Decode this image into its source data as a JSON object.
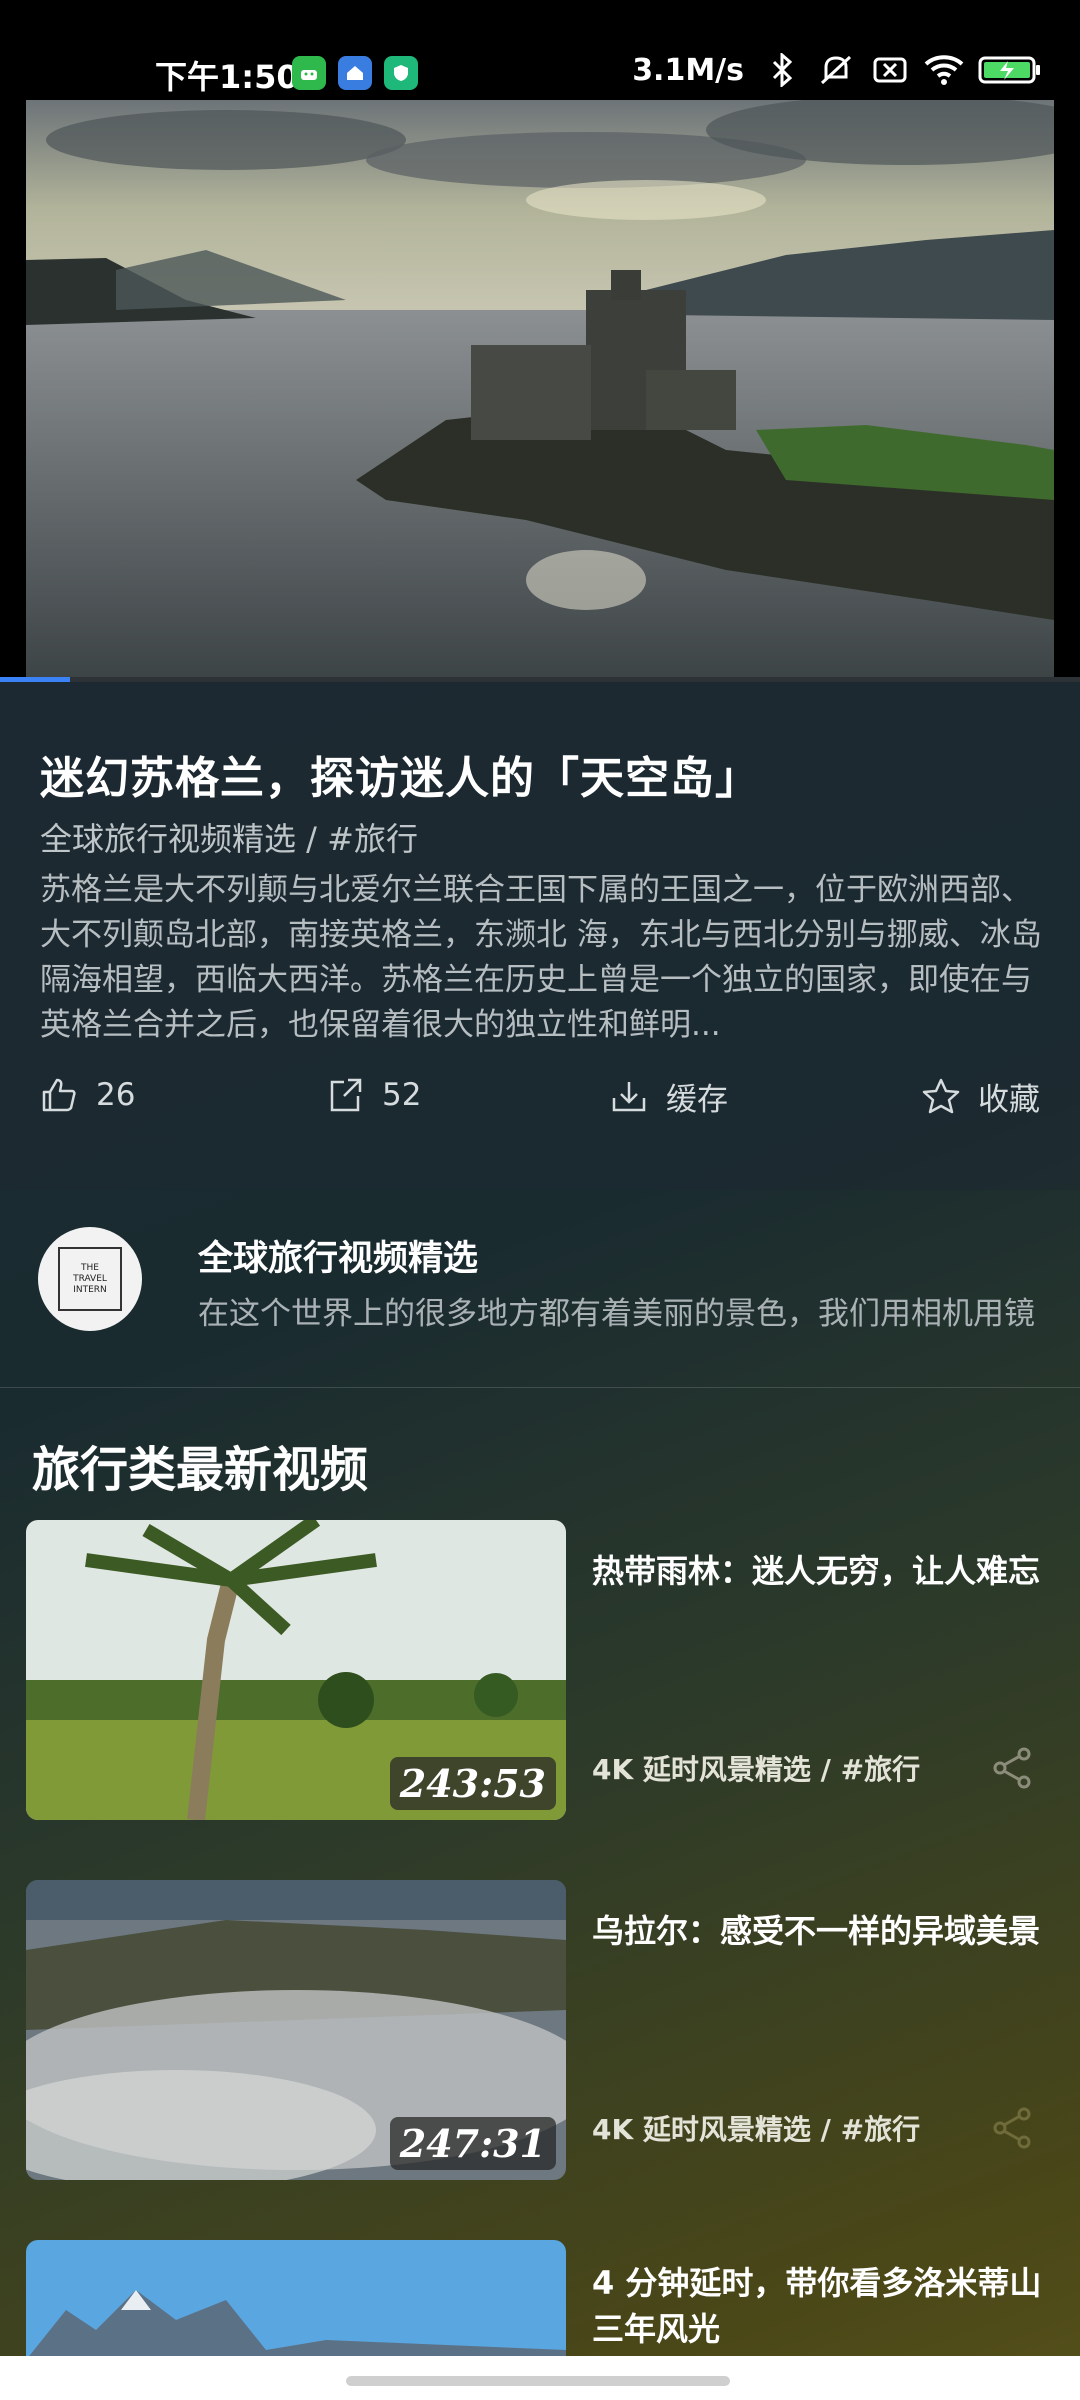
{
  "status_bar": {
    "time": "下午1:50",
    "network_speed": "3.1M/s",
    "icons": [
      "android-notif-icon",
      "home-notif-icon",
      "shield-notif-icon",
      "bluetooth-icon",
      "mute-icon",
      "no-sim-icon",
      "wifi-icon",
      "battery-charging-icon"
    ]
  },
  "player": {
    "progress": 0.065
  },
  "video": {
    "title": "迷幻苏格兰，探访迷人的「天空岛」",
    "subtitle": "全球旅行视频精选 / #旅行",
    "description": "苏格兰是大不列颠与北爱尔兰联合王国下属的王国之一，位于欧洲西部、大不列颠岛北部，南接英格兰，东濒北 海，东北与西北分别与挪威、冰岛隔海相望，西临大西洋。苏格兰在历史上曾是一个独立的国家，即使在与英格兰合并之后，也保留着很大的独立性和鲜明..."
  },
  "actions": {
    "like_count": "26",
    "share_count": "52",
    "cache_label": "缓存",
    "favorite_label": "收藏"
  },
  "channel": {
    "name": "全球旅行视频精选",
    "description": "在这个世界上的很多地方都有着美丽的景色，我们用相机用镜",
    "avatar_text": [
      "THE",
      "TRAVEL",
      "INTERN"
    ]
  },
  "section": {
    "title": "旅行类最新视频"
  },
  "videos": [
    {
      "title": "热带雨林：迷人无穷，让人难忘",
      "duration": "243:53",
      "meta": "4K 延时风景精选 / #旅行"
    },
    {
      "title": "乌拉尔：感受不一样的异域美景",
      "duration": "247:31",
      "meta": "4K 延时风景精选 / #旅行"
    },
    {
      "title": "4 分钟延时，带你看多洛米蒂山三年风光",
      "duration": "",
      "meta": ""
    }
  ]
}
